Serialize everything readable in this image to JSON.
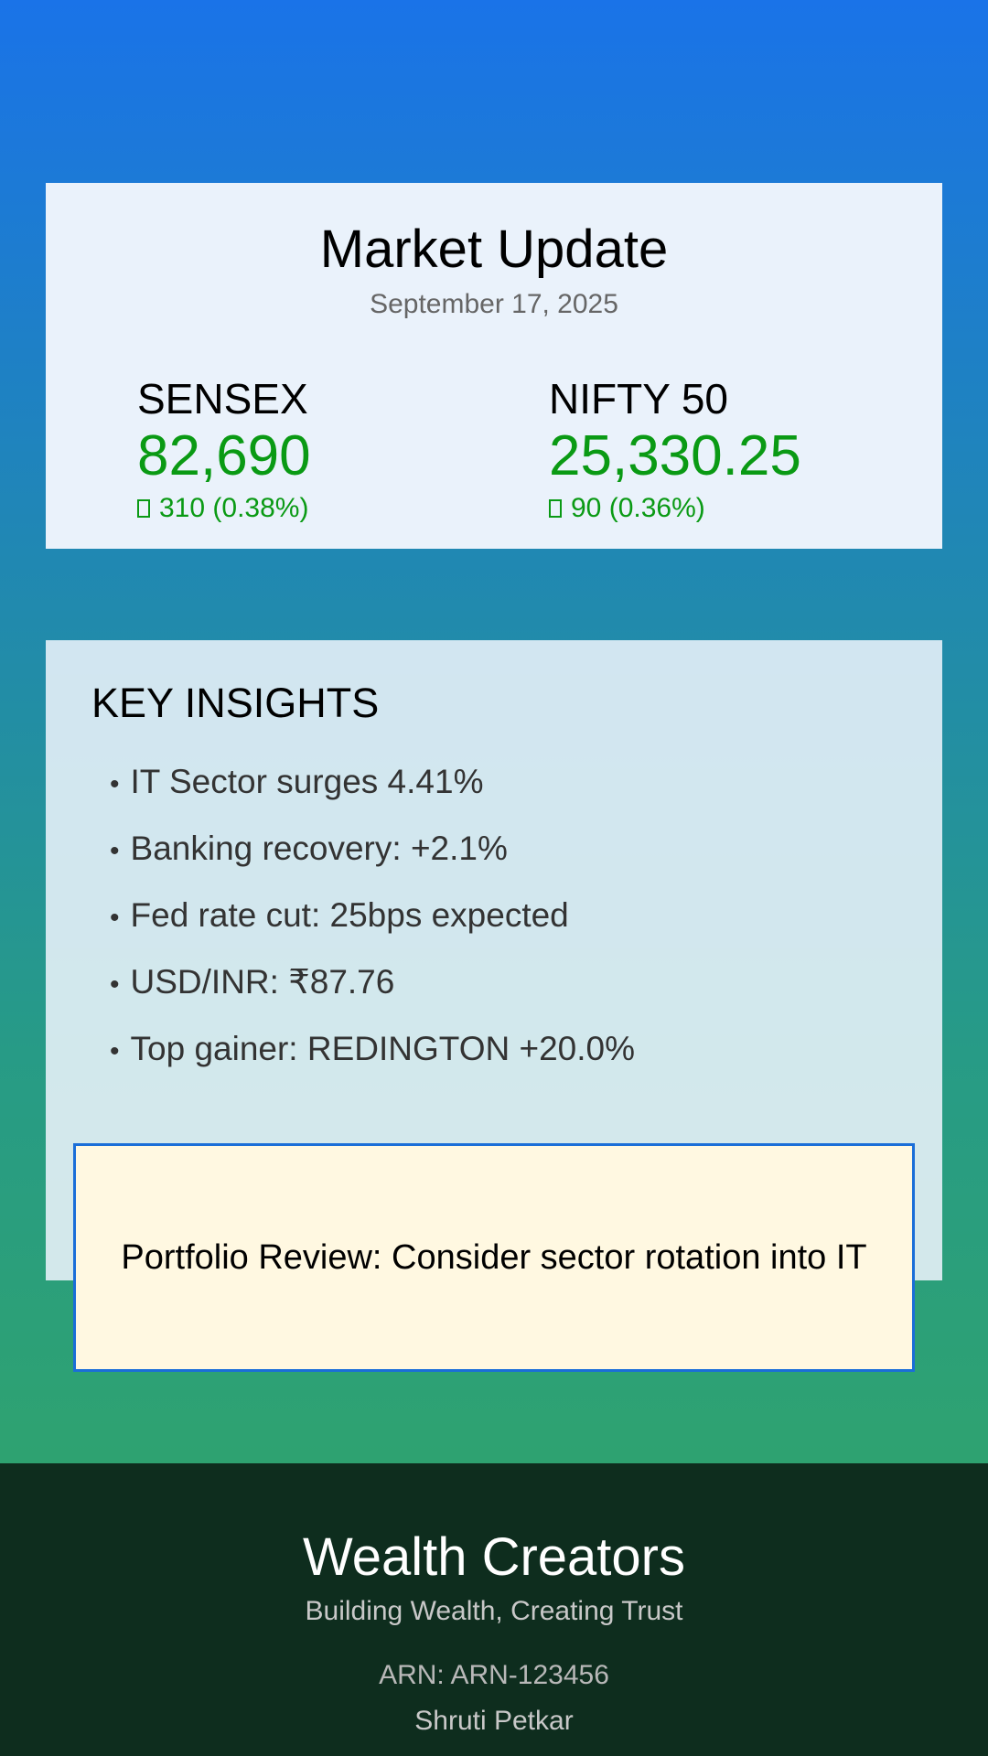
{
  "market": {
    "title": "Market Update",
    "date": "September 17, 2025",
    "indices": [
      {
        "name": "SENSEX",
        "value": "82,690",
        "change": "310 (0.38%)",
        "direction": "up"
      },
      {
        "name": "NIFTY 50",
        "value": "25,330.25",
        "change": "90 (0.36%)",
        "direction": "up"
      }
    ]
  },
  "insights": {
    "title": "KEY INSIGHTS",
    "bullet": "•",
    "items": [
      "IT Sector surges 4.41%",
      "Banking recovery: +2.1%",
      "Fed rate cut: 25bps expected",
      "USD/INR: ₹87.76",
      "Top gainer: REDINGTON +20.0%"
    ]
  },
  "review": {
    "text": "Portfolio Review: Consider sector rotation into IT"
  },
  "footer": {
    "brand": "Wealth Creators",
    "tagline": "Building Wealth, Creating Trust",
    "arn": "ARN: ARN-123456",
    "name": "Shruti Petkar"
  },
  "colors": {
    "gain": "#0a9a14",
    "background_top": "#1a73e8",
    "background_bottom": "#2fa36f",
    "footer": "#0e2d1e",
    "review_border": "#1a6ed8",
    "review_fill": "#fff8e1"
  }
}
